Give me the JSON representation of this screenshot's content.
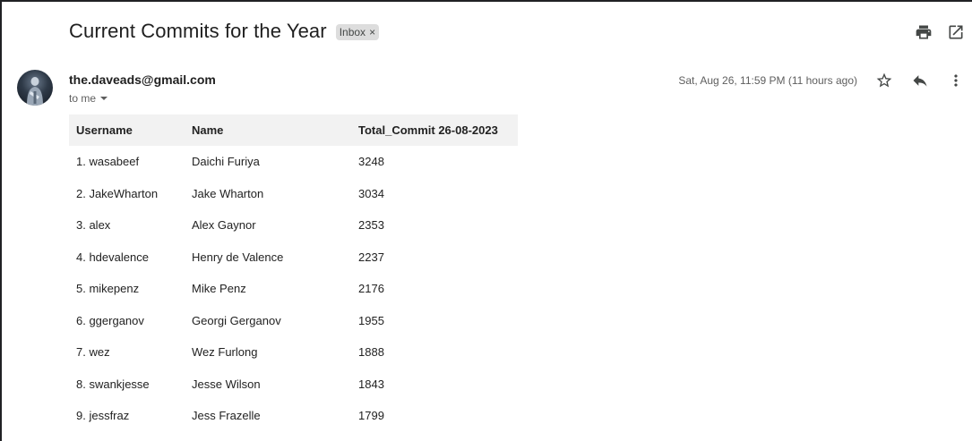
{
  "email": {
    "subject": "Current Commits for the Year",
    "label": "Inbox",
    "label_remove": "×",
    "sender": "the.daveads@gmail.com",
    "recipient": "to me",
    "date": "Sat, Aug 26, 11:59 PM (11 hours ago)"
  },
  "icons": {
    "print": "print-icon",
    "open_new": "open-in-new-window-icon",
    "star": "star-icon",
    "reply": "reply-icon",
    "more": "more-vert-icon",
    "dropdown": "chevron-down-icon"
  },
  "table": {
    "headers": [
      "Username",
      "Name",
      "Total_Commit 26-08-2023"
    ],
    "rows": [
      [
        "1. wasabeef",
        "Daichi Furiya",
        "3248"
      ],
      [
        "2. JakeWharton",
        "Jake Wharton",
        "3034"
      ],
      [
        "3. alex",
        "Alex Gaynor",
        "2353"
      ],
      [
        "4. hdevalence",
        "Henry de Valence",
        "2237"
      ],
      [
        "5. mikepenz",
        "Mike Penz",
        "2176"
      ],
      [
        "6. ggerganov",
        "Georgi Gerganov",
        "1955"
      ],
      [
        "7. wez",
        "Wez Furlong",
        "1888"
      ],
      [
        "8. swankjesse",
        "Jesse Wilson",
        "1843"
      ],
      [
        "9. jessfraz",
        "Jess Frazelle",
        "1799"
      ]
    ]
  }
}
